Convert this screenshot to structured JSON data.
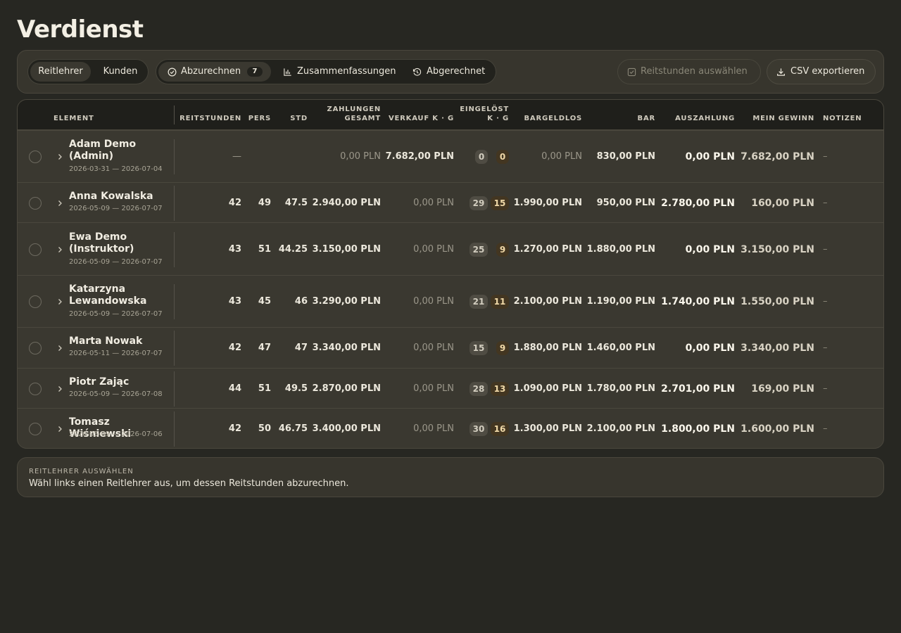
{
  "page": {
    "title": "Verdienst"
  },
  "toolbar": {
    "scope": {
      "instructors": "Reitlehrer",
      "customers": "Kunden"
    },
    "views": {
      "pending": "Abzurechnen",
      "pending_count": "7",
      "summaries": "Zusammenfassungen",
      "settled": "Abgerechnet"
    },
    "select_lessons": "Reitstunden auswählen",
    "export_csv": "CSV exportieren"
  },
  "table": {
    "headers": {
      "element": "ELEMENT",
      "lessons": "REITSTUNDEN",
      "pers": "PERS",
      "hours": "STD",
      "payments_total_1": "ZAHLUNGEN",
      "payments_total_2": "GESAMT",
      "sale": "VERKAUF K · G",
      "redeemed_1": "EINGELÖST",
      "redeemed_2": "K · G",
      "cashless": "BARGELDLOS",
      "cash": "BAR",
      "payout": "AUSZAHLUNG",
      "profit": "MEIN GEWINN",
      "notes": "NOTIZEN"
    },
    "rows": [
      {
        "name": "Adam Demo (Admin)",
        "dates": "2026-03-31 — 2026-07-04",
        "lessons": "—",
        "pers": "",
        "hours": "",
        "payments": "0,00 PLN",
        "sale": "7.682,00 PLN",
        "k": "0",
        "g": "0",
        "cashless": "0,00 PLN",
        "cash": "830,00 PLN",
        "payout": "0,00 PLN",
        "profit": "7.682,00 PLN",
        "note": "–"
      },
      {
        "name": "Anna Kowalska",
        "dates": "2026-05-09 — 2026-07-07",
        "lessons": "42",
        "pers": "49",
        "hours": "47.5",
        "payments": "2.940,00 PLN",
        "sale": "0,00 PLN",
        "k": "29",
        "g": "15",
        "cashless": "1.990,00 PLN",
        "cash": "950,00 PLN",
        "payout": "2.780,00 PLN",
        "profit": "160,00 PLN",
        "note": "–"
      },
      {
        "name": "Ewa Demo (Instruktor)",
        "dates": "2026-05-09 — 2026-07-07",
        "lessons": "43",
        "pers": "51",
        "hours": "44.25",
        "payments": "3.150,00 PLN",
        "sale": "0,00 PLN",
        "k": "25",
        "g": "9",
        "cashless": "1.270,00 PLN",
        "cash": "1.880,00 PLN",
        "payout": "0,00 PLN",
        "profit": "3.150,00 PLN",
        "note": "–"
      },
      {
        "name": "Katarzyna Lewandowska",
        "dates": "2026-05-09 — 2026-07-07",
        "lessons": "43",
        "pers": "45",
        "hours": "46",
        "payments": "3.290,00 PLN",
        "sale": "0,00 PLN",
        "k": "21",
        "g": "11",
        "cashless": "2.100,00 PLN",
        "cash": "1.190,00 PLN",
        "payout": "1.740,00 PLN",
        "profit": "1.550,00 PLN",
        "note": "–"
      },
      {
        "name": "Marta Nowak",
        "dates": "2026-05-11 — 2026-07-07",
        "lessons": "42",
        "pers": "47",
        "hours": "47",
        "payments": "3.340,00 PLN",
        "sale": "0,00 PLN",
        "k": "15",
        "g": "9",
        "cashless": "1.880,00 PLN",
        "cash": "1.460,00 PLN",
        "payout": "0,00 PLN",
        "profit": "3.340,00 PLN",
        "note": "–"
      },
      {
        "name": "Piotr Zając",
        "dates": "2026-05-09 — 2026-07-08",
        "lessons": "44",
        "pers": "51",
        "hours": "49.5",
        "payments": "2.870,00 PLN",
        "sale": "0,00 PLN",
        "k": "28",
        "g": "13",
        "cashless": "1.090,00 PLN",
        "cash": "1.780,00 PLN",
        "payout": "2.701,00 PLN",
        "profit": "169,00 PLN",
        "note": "–"
      },
      {
        "name": "Tomasz Wiśniewski",
        "dates": "2026-05-09 — 2026-07-06",
        "lessons": "42",
        "pers": "50",
        "hours": "46.75",
        "payments": "3.400,00 PLN",
        "sale": "0,00 PLN",
        "k": "30",
        "g": "16",
        "cashless": "1.300,00 PLN",
        "cash": "2.100,00 PLN",
        "payout": "1.800,00 PLN",
        "profit": "1.600,00 PLN",
        "note": "–"
      }
    ]
  },
  "info": {
    "title": "REITLEHRER AUSWÄHLEN",
    "text": "Wähl links einen Reitlehrer aus, um dessen Reitstunden abzurechnen."
  }
}
